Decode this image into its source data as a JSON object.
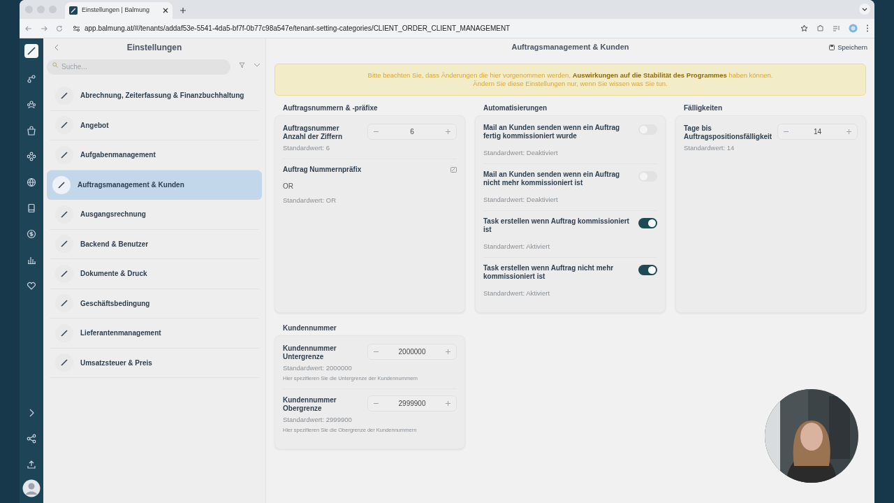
{
  "browser": {
    "tab_title": "Einstellungen | Balmung",
    "url": "app.balmung.at/#/tenants/addaf53e-5541-4da5-bf7f-0b77c98a547e/tenant-setting-categories/CLIENT_ORDER_CLIENT_MANAGEMENT"
  },
  "sidebar": {
    "title": "Einstellungen",
    "search": {
      "placeholder": "Suche..."
    },
    "items": [
      {
        "label": "Abrechnung, Zeiterfassung & Finanzbuchhaltung",
        "selected": false
      },
      {
        "label": "Angebot",
        "selected": false
      },
      {
        "label": "Aufgabenmanagement",
        "selected": false
      },
      {
        "label": "Auftragsmanagement & Kunden",
        "selected": true
      },
      {
        "label": "Ausgangsrechnung",
        "selected": false
      },
      {
        "label": "Backend & Benutzer",
        "selected": false
      },
      {
        "label": "Dokumente & Druck",
        "selected": false
      },
      {
        "label": "Geschäftsbedingung",
        "selected": false
      },
      {
        "label": "Lieferantenmanagement",
        "selected": false
      },
      {
        "label": "Umsatzsteuer & Preis",
        "selected": false
      }
    ]
  },
  "main": {
    "title": "Auftragsmanagement & Kunden",
    "save_label": "Speichern",
    "warning": [
      "Bitte beachten Sie, dass Änderungen die hier vorgenommen werden, **Auswirkungen auf die Stabilität des Programmes** haben können.",
      "Ändern Sie diese Einstellungen nur, wenn Sie wissen was Sie tun."
    ],
    "sections": [
      {
        "title": "Auftragsnummern & -präfixe",
        "settings": [
          {
            "kind": "number",
            "label": "Auftragsnummer Anzahl der Ziffern",
            "value": "6",
            "default": "Standardwert: 6"
          },
          {
            "kind": "text",
            "label": "Auftrag Nummernpräfix",
            "value": "OR",
            "default": "Standardwert: OR"
          }
        ]
      },
      {
        "title": "Automatisierungen",
        "settings": [
          {
            "kind": "toggle",
            "label": "Mail an Kunden senden wenn ein Auftrag fertig kommissioniert wurde",
            "on": false,
            "default": "Standardwert: Deaktiviert"
          },
          {
            "kind": "toggle",
            "label": "Mail an Kunden senden wenn ein Auftrag nicht mehr kommissioniert ist",
            "on": false,
            "default": "Standardwert: Deaktiviert"
          },
          {
            "kind": "toggle",
            "label": "Task erstellen wenn Auftrag kommissioniert ist",
            "on": true,
            "default": "Standardwert: Aktiviert"
          },
          {
            "kind": "toggle",
            "label": "Task erstellen wenn Auftrag nicht mehr kommissioniert ist",
            "on": true,
            "default": "Standardwert: Aktiviert"
          }
        ]
      },
      {
        "title": "Fälligkeiten",
        "settings": [
          {
            "kind": "number",
            "label": "Tage bis Auftragspositionsfälligkeit",
            "value": "14",
            "default": "Standardwert: 14"
          }
        ]
      },
      {
        "title": "Kundennummer",
        "settings": [
          {
            "kind": "number",
            "label": "Kundennummer Untergrenze",
            "value": "2000000",
            "default": "Standardwert: 2000000",
            "hint": "Hier spezifieren Sie die Untergrenze der Kundennummern"
          },
          {
            "kind": "number",
            "label": "Kundennummer Obergrenze",
            "value": "2999900",
            "default": "Standardwert: 2999900",
            "hint": "Hier spezifieren Sie die Obergrenze der Kundennummern"
          }
        ]
      }
    ]
  }
}
